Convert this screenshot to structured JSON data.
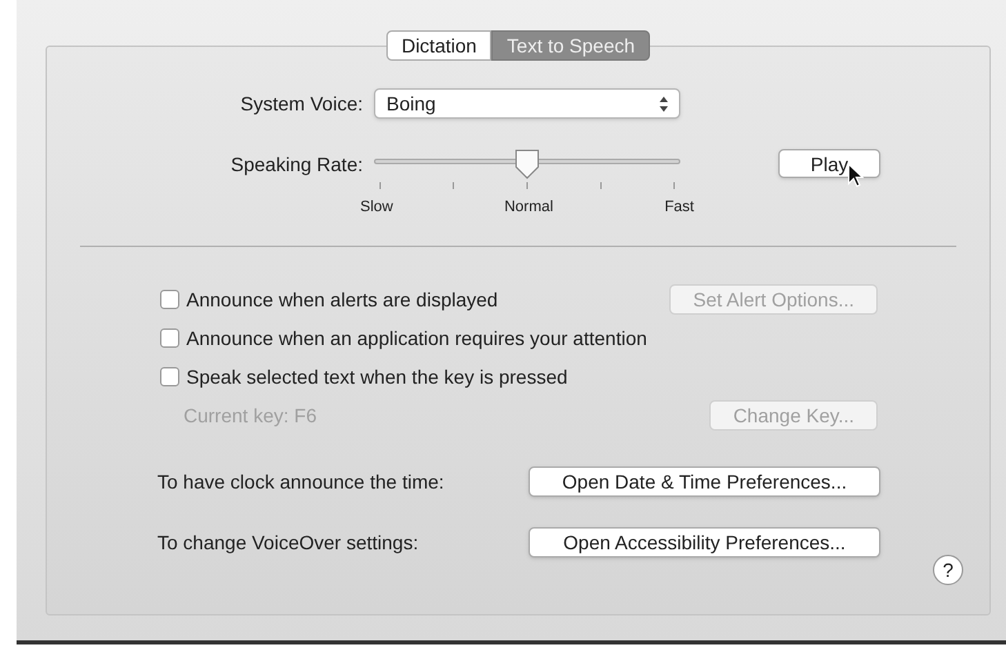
{
  "tabs": [
    {
      "label": "Dictation",
      "selected": false
    },
    {
      "label": "Text to Speech",
      "selected": true
    }
  ],
  "system_voice": {
    "label": "System Voice:",
    "value": "Boing"
  },
  "speaking_rate": {
    "label": "Speaking Rate:",
    "level": 0.5,
    "tick_labels": [
      "Slow",
      "Normal",
      "Fast"
    ]
  },
  "play_button": {
    "label": "Play"
  },
  "options": [
    {
      "kind": "checkbox",
      "label": "Announce when alerts are displayed",
      "checked": false,
      "button": {
        "label": "Set Alert Options...",
        "disabled": true
      }
    },
    {
      "kind": "checkbox",
      "label": "Announce when an application requires your attention",
      "checked": false
    },
    {
      "kind": "checkbox",
      "label": "Speak selected text when the key is pressed",
      "checked": false
    },
    {
      "kind": "note",
      "label": "Current key: F6",
      "disabled": true,
      "button": {
        "label": "Change Key...",
        "disabled": true
      }
    }
  ],
  "shortcuts": [
    {
      "label": "To have clock announce the time:",
      "button": "Open Date & Time Preferences..."
    },
    {
      "label": "To change VoiceOver settings:",
      "button": "Open Accessibility Preferences..."
    }
  ],
  "help_button": {
    "label": "?"
  }
}
